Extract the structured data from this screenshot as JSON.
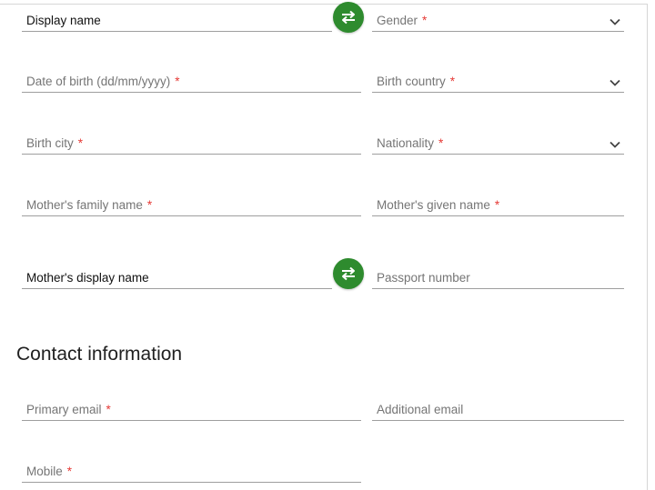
{
  "fields": {
    "display_name": {
      "value": "Display name"
    },
    "gender": {
      "label": "Gender",
      "required_mark": "*"
    },
    "date_of_birth": {
      "label": "Date of birth (dd/mm/yyyy)",
      "required_mark": "*"
    },
    "birth_country": {
      "label": "Birth country",
      "required_mark": "*"
    },
    "birth_city": {
      "label": "Birth city",
      "required_mark": "*"
    },
    "nationality": {
      "label": "Nationality",
      "required_mark": "*"
    },
    "mothers_family_name": {
      "label": "Mother's family name",
      "required_mark": "*"
    },
    "mothers_given_name": {
      "label": "Mother's given name",
      "required_mark": "*"
    },
    "mothers_display_name": {
      "value": "Mother's display name"
    },
    "passport_number": {
      "label": "Passport number"
    }
  },
  "contact": {
    "title": "Contact information",
    "primary_email": {
      "label": "Primary email",
      "required_mark": "*"
    },
    "additional_email": {
      "label": "Additional email"
    },
    "mobile": {
      "label": "Mobile",
      "required_mark": "*"
    }
  },
  "icons": {
    "swap": "swap-arrows-icon",
    "dropdown": "chevron-down-icon"
  },
  "colors": {
    "accent_green": "#2e8b2e",
    "required_red": "#e53935",
    "underline": "#9e9e9e",
    "placeholder": "#757575"
  }
}
